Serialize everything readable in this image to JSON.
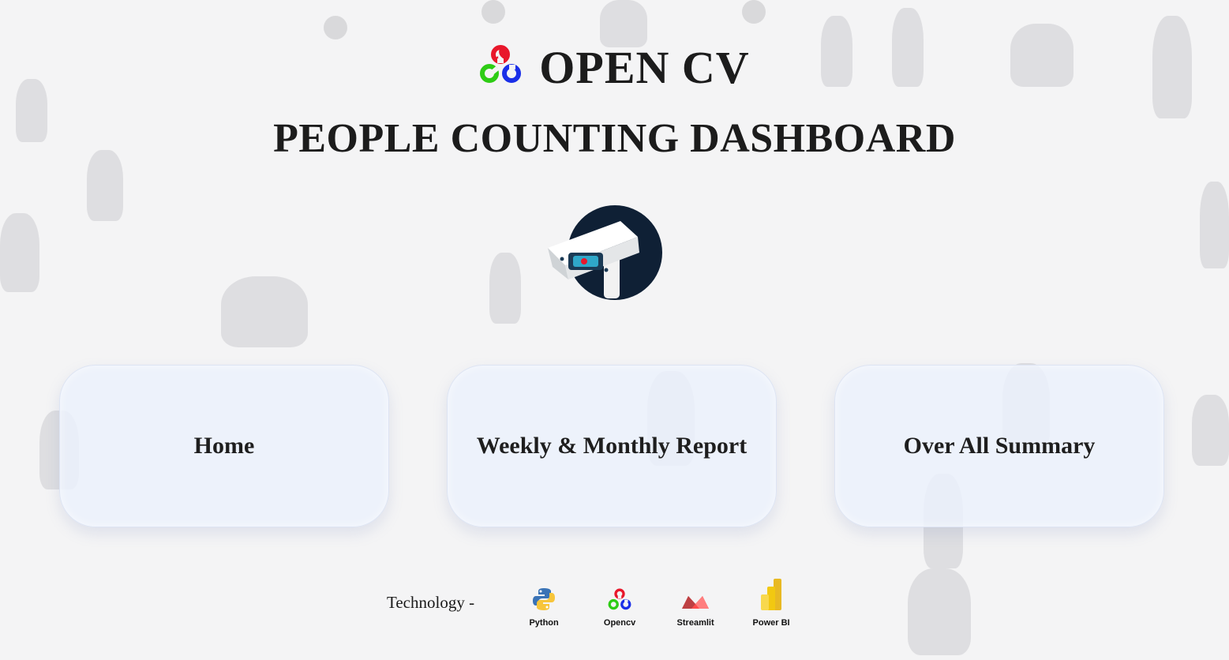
{
  "header": {
    "title": "OPEN CV",
    "subtitle": "PEOPLE COUNTING DASHBOARD",
    "logo_icon": "opencv-logo-icon",
    "center_icon": "cctv-camera-icon"
  },
  "nav": [
    {
      "label": "Home"
    },
    {
      "label": "Weekly & Monthly Report"
    },
    {
      "label": "Over All Summary"
    }
  ],
  "technology": {
    "label": "Technology -",
    "items": [
      {
        "name": "Python",
        "icon": "python-icon"
      },
      {
        "name": "Opencv",
        "icon": "opencv-icon"
      },
      {
        "name": "Streamlit",
        "icon": "streamlit-icon"
      },
      {
        "name": "Power BI",
        "icon": "powerbi-icon"
      }
    ]
  },
  "colors": {
    "background": "#f4f4f5",
    "card": "#ecf1fc",
    "text": "#1c1c1c",
    "opencv_red": "#e8172b",
    "opencv_green": "#2ecc15",
    "opencv_blue": "#1a2fe8",
    "camera_circle": "#0f2035"
  }
}
